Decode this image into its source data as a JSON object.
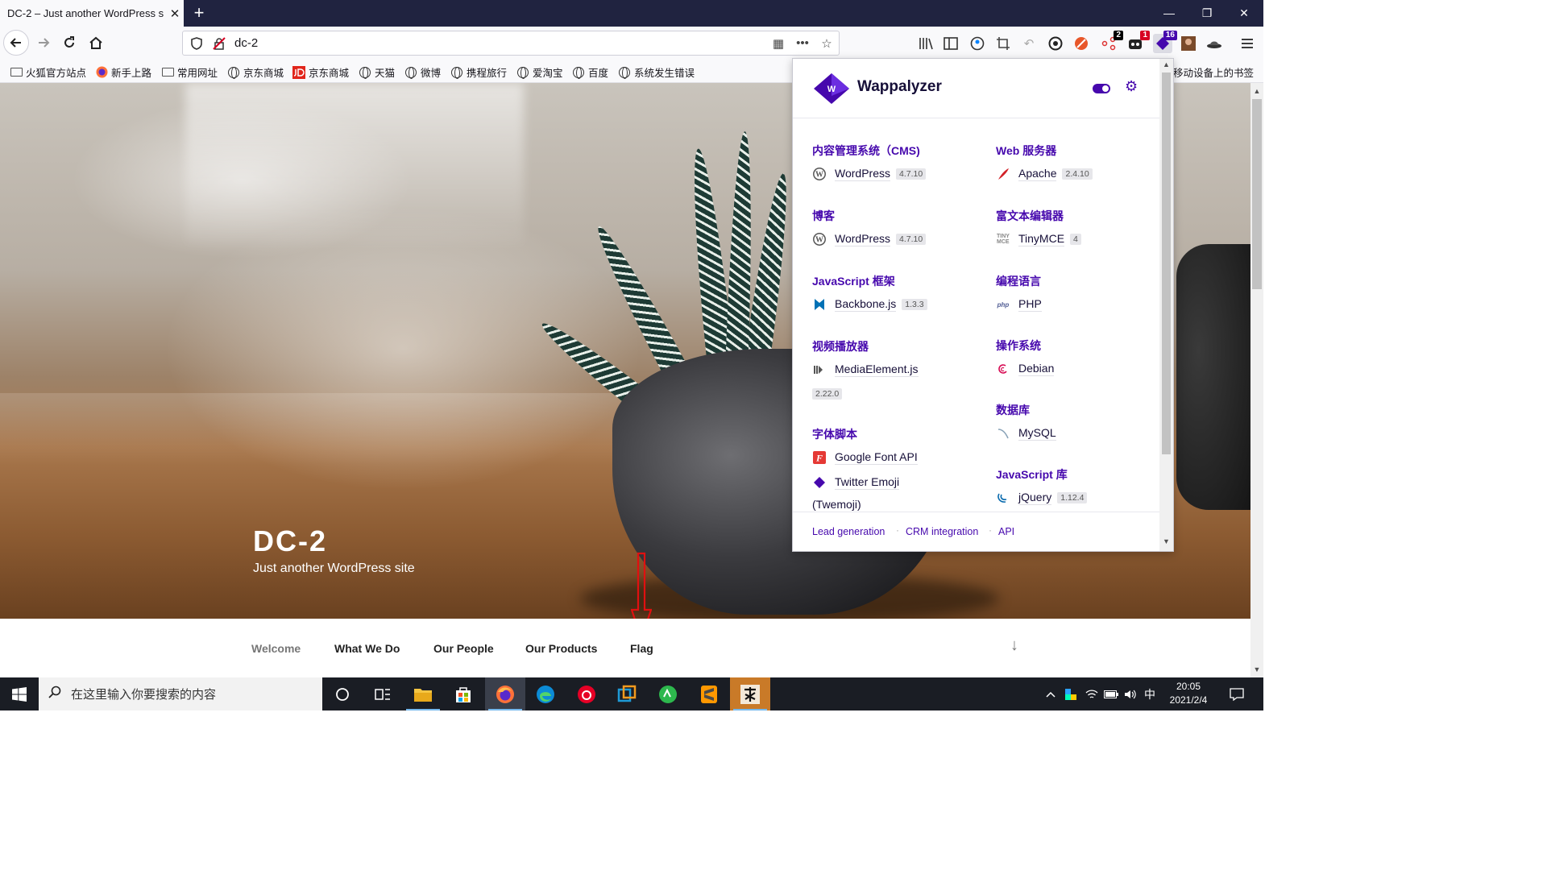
{
  "browser": {
    "tab_title": "DC-2 – Just another WordPress s",
    "tab_close": "✕",
    "new_tab": "+",
    "window_controls": {
      "minimize": "—",
      "maximize": "❐",
      "close": "✕"
    },
    "url": "dc-2",
    "badges": {
      "extension_a": "2",
      "extension_b": "1",
      "wappalyzer": "16"
    }
  },
  "bookmarks": {
    "items": [
      "火狐官方站点",
      "新手上路",
      "常用网址",
      "京东商城",
      "京东商城",
      "天猫",
      "微博",
      "携程旅行",
      "爱淘宝",
      "百度",
      "系统发生错误"
    ],
    "mobile": "移动设备上的书签"
  },
  "site": {
    "title": "DC-2",
    "description": "Just another WordPress site",
    "menu": [
      "Welcome",
      "What We Do",
      "Our People",
      "Our Products",
      "Flag"
    ],
    "scroll_arrow": "↓"
  },
  "wappalyzer": {
    "name": "Wappalyzer",
    "left_col": [
      {
        "category": "内容管理系统（CMS)",
        "techs": [
          {
            "name": "WordPress",
            "version": "4.7.10",
            "icon": "wordpress-icon"
          }
        ]
      },
      {
        "category": "博客",
        "techs": [
          {
            "name": "WordPress",
            "version": "4.7.10",
            "icon": "wordpress-icon"
          }
        ]
      },
      {
        "category": "JavaScript 框架",
        "techs": [
          {
            "name": "Backbone.js",
            "version": "1.3.3",
            "icon": "backbone-icon"
          }
        ]
      },
      {
        "category": "视频播放器",
        "techs": [
          {
            "name": "MediaElement.js",
            "version": "2.22.0",
            "icon": "mediaelement-icon"
          }
        ]
      },
      {
        "category": "字体脚本",
        "techs": [
          {
            "name": "Google Font API",
            "version": "",
            "icon": "google-font-icon"
          },
          {
            "name": "Twitter Emoji",
            "name_cont": "(Twemoji)",
            "version": "",
            "icon": "twemoji-icon"
          }
        ]
      }
    ],
    "right_col": [
      {
        "category": "Web 服务器",
        "techs": [
          {
            "name": "Apache",
            "version": "2.4.10",
            "icon": "apache-feather-icon"
          }
        ]
      },
      {
        "category": "富文本编辑器",
        "techs": [
          {
            "name": "TinyMCE",
            "version": "4",
            "icon": "tinymce-icon"
          }
        ]
      },
      {
        "category": "编程语言",
        "techs": [
          {
            "name": "PHP",
            "version": "",
            "icon": "php-icon"
          }
        ]
      },
      {
        "category": "操作系统",
        "techs": [
          {
            "name": "Debian",
            "version": "",
            "icon": "debian-icon"
          }
        ]
      },
      {
        "category": "数据库",
        "techs": [
          {
            "name": "MySQL",
            "version": "",
            "icon": "mysql-icon"
          }
        ]
      },
      {
        "category": "JavaScript 库",
        "techs": [
          {
            "name": "jQuery",
            "version": "1.12.4",
            "icon": "jquery-icon"
          }
        ]
      }
    ],
    "footer_links": [
      "Lead generation",
      "CRM integration",
      "API"
    ]
  },
  "taskbar": {
    "search_placeholder": "在这里输入你要搜索的内容",
    "ime": "中",
    "time": "20:05",
    "date": "2021/2/4"
  },
  "colors": {
    "accent": "#4608ad",
    "tabstrip": "#202340",
    "taskbar": "#1a1d24"
  }
}
